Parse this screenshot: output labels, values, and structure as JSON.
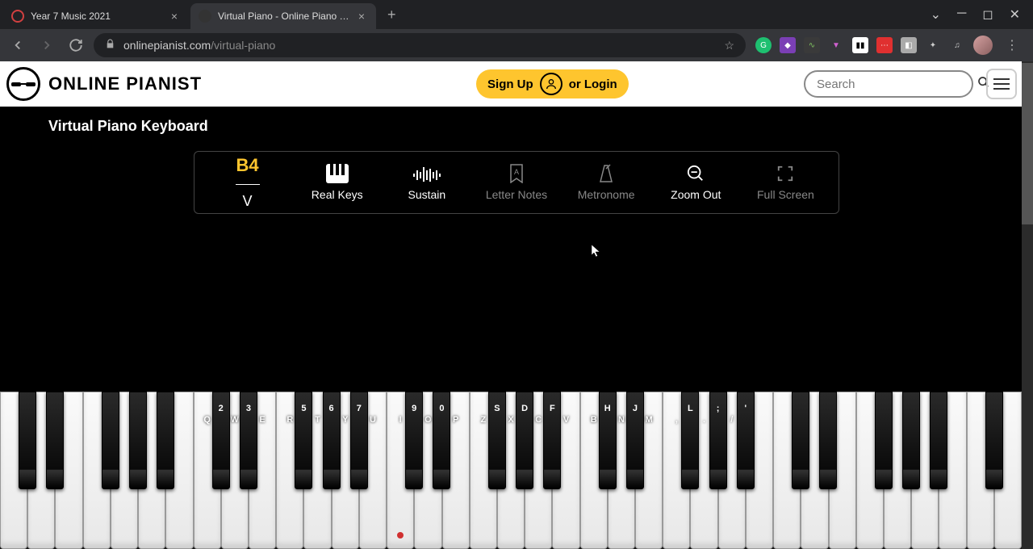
{
  "browser": {
    "tabs": [
      {
        "title": "Year 7 Music 2021",
        "active": false
      },
      {
        "title": "Virtual Piano - Online Piano Keyb",
        "active": true
      }
    ],
    "url_domain": "onlinepianist.com",
    "url_path": "/virtual-piano"
  },
  "header": {
    "logo_text": "ONLINE PIANIST",
    "signup": "Sign Up",
    "or_login": "or Login",
    "search_placeholder": "Search"
  },
  "page_title": "Virtual Piano Keyboard",
  "toolbar": {
    "current_note": "B4",
    "current_key": "V",
    "items": [
      {
        "label": "Real Keys",
        "icon": "piano-keys-icon",
        "dim": false
      },
      {
        "label": "Sustain",
        "icon": "waveform-icon",
        "dim": false
      },
      {
        "label": "Letter Notes",
        "icon": "bookmark-a-icon",
        "dim": true
      },
      {
        "label": "Metronome",
        "icon": "metronome-icon",
        "dim": true
      },
      {
        "label": "Zoom Out",
        "icon": "magnify-minus-icon",
        "dim": false
      },
      {
        "label": "Full Screen",
        "icon": "expand-icon",
        "dim": true
      }
    ]
  },
  "piano": {
    "white_labels": [
      "",
      "",
      "",
      "",
      "",
      "",
      "",
      "Q",
      "W",
      "E",
      "R",
      "T",
      "Y",
      "U",
      "I",
      "O",
      "P",
      "Z",
      "X",
      "C",
      "V",
      "B",
      "N",
      "M",
      ",",
      ".",
      "/",
      "",
      "",
      "",
      "",
      "",
      "",
      "",
      "",
      "",
      ""
    ],
    "black_pattern": [
      1,
      1,
      0,
      1,
      1,
      1,
      0
    ],
    "black_labels": {
      "8": "2",
      "9": "3",
      "11": "5",
      "12": "6",
      "13": "7",
      "15": "9",
      "16": "0",
      "18": "S",
      "19": "D",
      "20": "F",
      "22": "H",
      "23": "J",
      "25": "L",
      "26": ";",
      "27": "'"
    },
    "middle_c_white_index": 14
  }
}
